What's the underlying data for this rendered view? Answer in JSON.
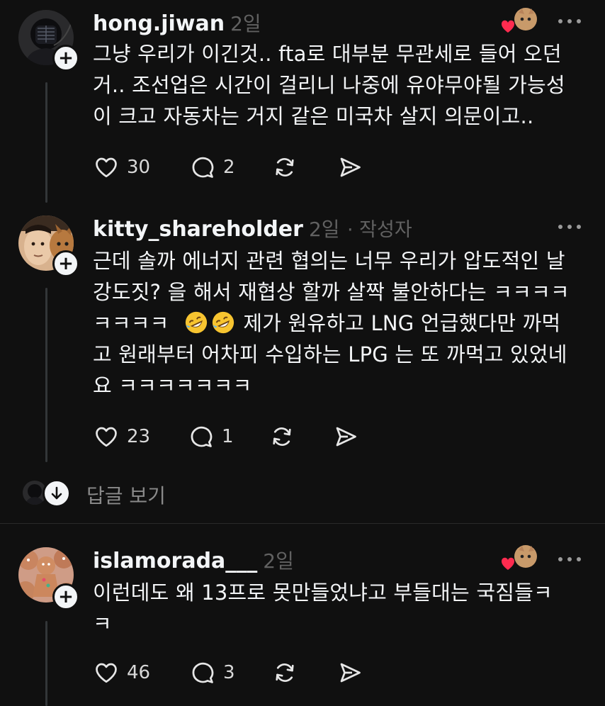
{
  "posts": [
    {
      "username": "hong.jiwan",
      "time": "2일",
      "author_tag": "",
      "lines": [
        "그냥 우리가 이긴것.. fta로 대부분 무관세로 들어 오던",
        "거.. 조선업은 시간이 걸리니 나중에 유야무야될 가능성",
        "이 크고 자동차는 거지 같은 미국차 살지 의문이고.."
      ],
      "likes": "30",
      "replies": "2"
    },
    {
      "username": "kitty_shareholder",
      "time": "2일",
      "author_tag": "· 작성자",
      "lines": [
        "근데 솔까 에너지 관련 협의는 너무 우리가 압도적인 날",
        "강도짓? 을 해서 재협상 할까 살짝 불안하다는 ㅋㅋㅋㅋ",
        "ㅋㅋㅋㅋ",
        "제가 원유하고 LNG 언급했다만 까먹",
        "고 원래부터 어차피 수입하는 LPG 는 또 까먹고 있었네",
        "요 ㅋㅋㅋㅋㅋㅋㅋ"
      ],
      "likes": "23",
      "replies": "1"
    },
    {
      "username": "islamorada___",
      "time": "2일",
      "author_tag": "",
      "lines": [
        "이런데도 왜 13프로 못만들었냐고 부들대는  국짐들ㅋ",
        "ㅋ"
      ],
      "likes": "46",
      "replies": "3"
    }
  ],
  "view_replies_label": "답글 보기",
  "colors": {
    "background": "#101010",
    "text": "#f3f5f7",
    "muted": "#616161",
    "heart": "#ff2b4f"
  },
  "icons": [
    "heart-icon",
    "comment-icon",
    "repost-icon",
    "share-icon",
    "more-icon",
    "plus-icon",
    "arrow-down-icon",
    "rofl-emoji"
  ]
}
